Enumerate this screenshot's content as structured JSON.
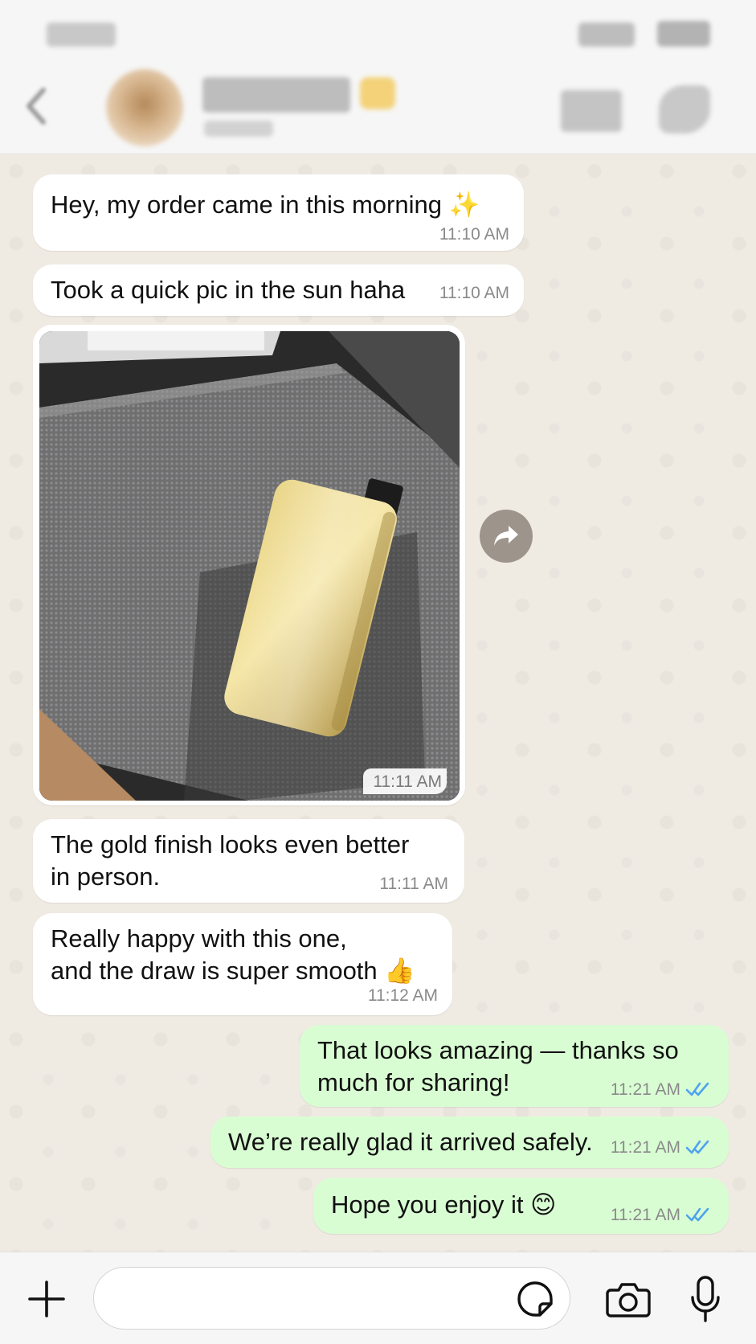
{
  "header": {
    "status_time": "",
    "contact_name": "",
    "contact_status": ""
  },
  "messages": [
    {
      "direction": "in",
      "text": "Hey, my order came in this morning ✨",
      "time": "11:10 AM"
    },
    {
      "direction": "in",
      "text": "Took a quick pic in the sun haha",
      "time": "11:10 AM"
    },
    {
      "direction": "in",
      "type": "image",
      "time": "11:11 AM"
    },
    {
      "direction": "in",
      "text": "The gold finish looks even better\nin person.",
      "time": "11:11 AM"
    },
    {
      "direction": "in",
      "text": "Really happy with this one,\nand the draw is super smooth 👍",
      "time": "11:12 AM"
    },
    {
      "direction": "out",
      "text": "That looks amazing — thanks so\nmuch for sharing!",
      "time": "11:21 AM",
      "status": "read"
    },
    {
      "direction": "out",
      "text": "We’re really glad it arrived safely.",
      "time": "11:21 AM",
      "status": "read"
    },
    {
      "direction": "out",
      "text": "Hope you enjoy it 😊",
      "time": "11:21 AM",
      "status": "read"
    }
  ],
  "composer": {
    "placeholder": ""
  },
  "icons": {
    "back": "chevron-left-icon",
    "video": "video-camera-icon",
    "call": "phone-icon",
    "forward": "forward-arrow-icon",
    "plus": "plus-icon",
    "sticker": "sticker-icon",
    "camera": "camera-icon",
    "mic": "microphone-icon",
    "read": "double-check-icon"
  },
  "colors": {
    "incoming_bubble": "#ffffff",
    "outgoing_bubble": "#d9fdd3",
    "chat_background": "#efeae2",
    "read_ticks": "#4da3f0"
  }
}
